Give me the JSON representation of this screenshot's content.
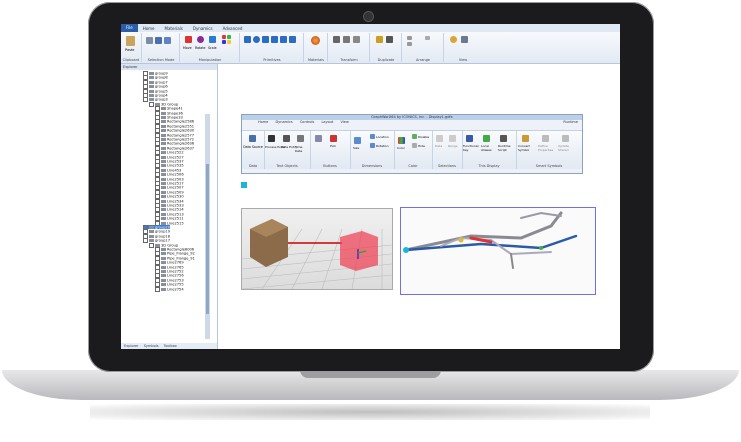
{
  "tabs": [
    "File",
    "Home",
    "Materials",
    "Dynamics",
    "Advanced"
  ],
  "ribbon_groups": [
    "Clipboard",
    "Selection Mode",
    "Manipulation",
    "Primitives",
    "Materials",
    "Transform",
    "Duplicate",
    "Arrange",
    "View"
  ],
  "ribbon_small": [
    "Paste",
    "Move",
    "Rotate",
    "Scale"
  ],
  "explorer": {
    "title": "Explorer",
    "rows": [
      "group9",
      "group8",
      "group7",
      "group6",
      "group5",
      "group4",
      "group3",
      "3D Group",
      "Shape41",
      "Shape36",
      "Shape33",
      "Rectangle2586",
      "Rectangle2551",
      "Rectangle2630",
      "Rectangle2577",
      "Rectangle2572",
      "Rectangle2636",
      "Rectangle2637",
      "Line2522",
      "Line2527",
      "Line2537",
      "Line2535",
      "Line453",
      "Line2506",
      "Line2503",
      "Line2517",
      "Line2507",
      "Line2509",
      "Line2530",
      "Line2534",
      "Line2533",
      "Line2514",
      "Line2513",
      "Line2511",
      "Line2515",
      "group20",
      "group19",
      "group18",
      "group17",
      "3D Group",
      "Rectangle8006",
      "Pipe_Flange_92",
      "Pipe_Flange_91",
      "Line2769",
      "Line2765",
      "Line2752",
      "Line2756",
      "Line2753",
      "Line2755",
      "Line2754"
    ],
    "selected_index": 35,
    "selected_label": "Line2515",
    "bottom_tabs": [
      "Explorer",
      "Symbols",
      "Toolbox"
    ]
  },
  "inner": {
    "title": "GraphWorX64 by ICONICS, Inc. - Display1.gdfx",
    "tabs": [
      "Home",
      "Dynamics",
      "Controls",
      "Layout",
      "View"
    ],
    "runtime": "Runtime",
    "groups": [
      "Data",
      "Text Objects",
      "Buttons",
      "Dimensions",
      "Color",
      "Selections",
      "This Display",
      "Smart Symbols"
    ],
    "buttons": [
      "Data Source",
      "Process Point",
      "Date Entry",
      "Time Date",
      "Pick",
      "Size",
      "Location",
      "Rotation",
      "Color",
      "Disable",
      "Hide",
      "Data",
      "Range",
      "Functional Key",
      "Local Aliases",
      "Runtime Script",
      "Convert Symbol",
      "Define Properties",
      "Update Shared"
    ]
  }
}
